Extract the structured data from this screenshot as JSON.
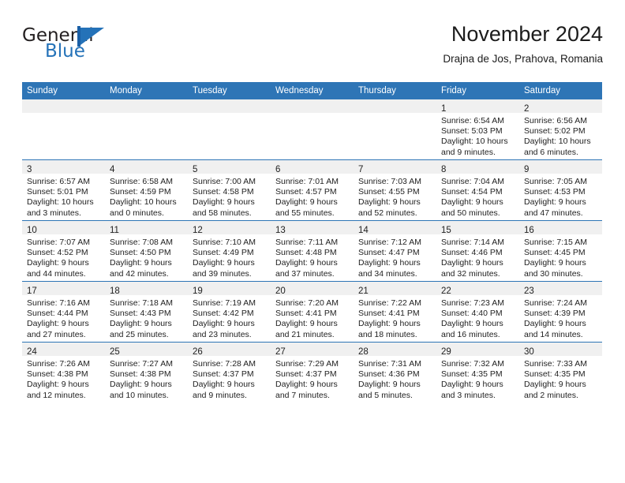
{
  "logo": {
    "word_top": "General",
    "word_bottom": "Blue",
    "mark_name": "blue-flag-triangle"
  },
  "header": {
    "title": "November 2024",
    "subtitle": "Drajna de Jos, Prahova, Romania"
  },
  "colors": {
    "header_blue": "#2e75b6",
    "daynum_strip": "#f0f0f0",
    "logo_blue": "#2472b8",
    "text": "#222222"
  },
  "calendar": {
    "weekday_headers": [
      "Sunday",
      "Monday",
      "Tuesday",
      "Wednesday",
      "Thursday",
      "Friday",
      "Saturday"
    ],
    "weeks": [
      [
        {
          "day": "",
          "sunrise": "",
          "sunset": "",
          "daylight1": "",
          "daylight2": ""
        },
        {
          "day": "",
          "sunrise": "",
          "sunset": "",
          "daylight1": "",
          "daylight2": ""
        },
        {
          "day": "",
          "sunrise": "",
          "sunset": "",
          "daylight1": "",
          "daylight2": ""
        },
        {
          "day": "",
          "sunrise": "",
          "sunset": "",
          "daylight1": "",
          "daylight2": ""
        },
        {
          "day": "",
          "sunrise": "",
          "sunset": "",
          "daylight1": "",
          "daylight2": ""
        },
        {
          "day": "1",
          "sunrise": "Sunrise: 6:54 AM",
          "sunset": "Sunset: 5:03 PM",
          "daylight1": "Daylight: 10 hours",
          "daylight2": "and 9 minutes."
        },
        {
          "day": "2",
          "sunrise": "Sunrise: 6:56 AM",
          "sunset": "Sunset: 5:02 PM",
          "daylight1": "Daylight: 10 hours",
          "daylight2": "and 6 minutes."
        }
      ],
      [
        {
          "day": "3",
          "sunrise": "Sunrise: 6:57 AM",
          "sunset": "Sunset: 5:01 PM",
          "daylight1": "Daylight: 10 hours",
          "daylight2": "and 3 minutes."
        },
        {
          "day": "4",
          "sunrise": "Sunrise: 6:58 AM",
          "sunset": "Sunset: 4:59 PM",
          "daylight1": "Daylight: 10 hours",
          "daylight2": "and 0 minutes."
        },
        {
          "day": "5",
          "sunrise": "Sunrise: 7:00 AM",
          "sunset": "Sunset: 4:58 PM",
          "daylight1": "Daylight: 9 hours",
          "daylight2": "and 58 minutes."
        },
        {
          "day": "6",
          "sunrise": "Sunrise: 7:01 AM",
          "sunset": "Sunset: 4:57 PM",
          "daylight1": "Daylight: 9 hours",
          "daylight2": "and 55 minutes."
        },
        {
          "day": "7",
          "sunrise": "Sunrise: 7:03 AM",
          "sunset": "Sunset: 4:55 PM",
          "daylight1": "Daylight: 9 hours",
          "daylight2": "and 52 minutes."
        },
        {
          "day": "8",
          "sunrise": "Sunrise: 7:04 AM",
          "sunset": "Sunset: 4:54 PM",
          "daylight1": "Daylight: 9 hours",
          "daylight2": "and 50 minutes."
        },
        {
          "day": "9",
          "sunrise": "Sunrise: 7:05 AM",
          "sunset": "Sunset: 4:53 PM",
          "daylight1": "Daylight: 9 hours",
          "daylight2": "and 47 minutes."
        }
      ],
      [
        {
          "day": "10",
          "sunrise": "Sunrise: 7:07 AM",
          "sunset": "Sunset: 4:52 PM",
          "daylight1": "Daylight: 9 hours",
          "daylight2": "and 44 minutes."
        },
        {
          "day": "11",
          "sunrise": "Sunrise: 7:08 AM",
          "sunset": "Sunset: 4:50 PM",
          "daylight1": "Daylight: 9 hours",
          "daylight2": "and 42 minutes."
        },
        {
          "day": "12",
          "sunrise": "Sunrise: 7:10 AM",
          "sunset": "Sunset: 4:49 PM",
          "daylight1": "Daylight: 9 hours",
          "daylight2": "and 39 minutes."
        },
        {
          "day": "13",
          "sunrise": "Sunrise: 7:11 AM",
          "sunset": "Sunset: 4:48 PM",
          "daylight1": "Daylight: 9 hours",
          "daylight2": "and 37 minutes."
        },
        {
          "day": "14",
          "sunrise": "Sunrise: 7:12 AM",
          "sunset": "Sunset: 4:47 PM",
          "daylight1": "Daylight: 9 hours",
          "daylight2": "and 34 minutes."
        },
        {
          "day": "15",
          "sunrise": "Sunrise: 7:14 AM",
          "sunset": "Sunset: 4:46 PM",
          "daylight1": "Daylight: 9 hours",
          "daylight2": "and 32 minutes."
        },
        {
          "day": "16",
          "sunrise": "Sunrise: 7:15 AM",
          "sunset": "Sunset: 4:45 PM",
          "daylight1": "Daylight: 9 hours",
          "daylight2": "and 30 minutes."
        }
      ],
      [
        {
          "day": "17",
          "sunrise": "Sunrise: 7:16 AM",
          "sunset": "Sunset: 4:44 PM",
          "daylight1": "Daylight: 9 hours",
          "daylight2": "and 27 minutes."
        },
        {
          "day": "18",
          "sunrise": "Sunrise: 7:18 AM",
          "sunset": "Sunset: 4:43 PM",
          "daylight1": "Daylight: 9 hours",
          "daylight2": "and 25 minutes."
        },
        {
          "day": "19",
          "sunrise": "Sunrise: 7:19 AM",
          "sunset": "Sunset: 4:42 PM",
          "daylight1": "Daylight: 9 hours",
          "daylight2": "and 23 minutes."
        },
        {
          "day": "20",
          "sunrise": "Sunrise: 7:20 AM",
          "sunset": "Sunset: 4:41 PM",
          "daylight1": "Daylight: 9 hours",
          "daylight2": "and 21 minutes."
        },
        {
          "day": "21",
          "sunrise": "Sunrise: 7:22 AM",
          "sunset": "Sunset: 4:41 PM",
          "daylight1": "Daylight: 9 hours",
          "daylight2": "and 18 minutes."
        },
        {
          "day": "22",
          "sunrise": "Sunrise: 7:23 AM",
          "sunset": "Sunset: 4:40 PM",
          "daylight1": "Daylight: 9 hours",
          "daylight2": "and 16 minutes."
        },
        {
          "day": "23",
          "sunrise": "Sunrise: 7:24 AM",
          "sunset": "Sunset: 4:39 PM",
          "daylight1": "Daylight: 9 hours",
          "daylight2": "and 14 minutes."
        }
      ],
      [
        {
          "day": "24",
          "sunrise": "Sunrise: 7:26 AM",
          "sunset": "Sunset: 4:38 PM",
          "daylight1": "Daylight: 9 hours",
          "daylight2": "and 12 minutes."
        },
        {
          "day": "25",
          "sunrise": "Sunrise: 7:27 AM",
          "sunset": "Sunset: 4:38 PM",
          "daylight1": "Daylight: 9 hours",
          "daylight2": "and 10 minutes."
        },
        {
          "day": "26",
          "sunrise": "Sunrise: 7:28 AM",
          "sunset": "Sunset: 4:37 PM",
          "daylight1": "Daylight: 9 hours",
          "daylight2": "and 9 minutes."
        },
        {
          "day": "27",
          "sunrise": "Sunrise: 7:29 AM",
          "sunset": "Sunset: 4:37 PM",
          "daylight1": "Daylight: 9 hours",
          "daylight2": "and 7 minutes."
        },
        {
          "day": "28",
          "sunrise": "Sunrise: 7:31 AM",
          "sunset": "Sunset: 4:36 PM",
          "daylight1": "Daylight: 9 hours",
          "daylight2": "and 5 minutes."
        },
        {
          "day": "29",
          "sunrise": "Sunrise: 7:32 AM",
          "sunset": "Sunset: 4:35 PM",
          "daylight1": "Daylight: 9 hours",
          "daylight2": "and 3 minutes."
        },
        {
          "day": "30",
          "sunrise": "Sunrise: 7:33 AM",
          "sunset": "Sunset: 4:35 PM",
          "daylight1": "Daylight: 9 hours",
          "daylight2": "and 2 minutes."
        }
      ]
    ]
  }
}
